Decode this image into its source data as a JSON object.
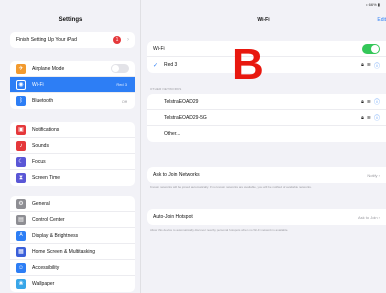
{
  "status": {
    "time": "1:24 PM  Sat Jan 20",
    "right": "• 66% ▮"
  },
  "sidebar": {
    "title": "Settings",
    "setup": {
      "label": "Finish Setting Up Your iPad",
      "badge": "1"
    },
    "group1": [
      {
        "name": "airplane",
        "label": "Airplane Mode",
        "icon": "✈",
        "color": "#f29a2e",
        "value": ""
      },
      {
        "name": "wifi",
        "label": "Wi-Fi",
        "icon": "◉",
        "color": "#2d7ef5",
        "value": "Red 3"
      },
      {
        "name": "bluetooth",
        "label": "Bluetooth",
        "icon": "ᛒ",
        "color": "#2d7ef5",
        "value": "Off"
      }
    ],
    "group2": [
      {
        "name": "notifications",
        "label": "Notifications",
        "icon": "▣",
        "color": "#e5383b"
      },
      {
        "name": "sounds",
        "label": "Sounds",
        "icon": "♪",
        "color": "#e5383b"
      },
      {
        "name": "focus",
        "label": "Focus",
        "icon": "☾",
        "color": "#5a57d6"
      },
      {
        "name": "screen-time",
        "label": "Screen Time",
        "icon": "⧗",
        "color": "#5a57d6"
      }
    ],
    "group3": [
      {
        "name": "general",
        "label": "General",
        "icon": "⚙",
        "color": "#8e8e93"
      },
      {
        "name": "control-center",
        "label": "Control Center",
        "icon": "▤",
        "color": "#8e8e93"
      },
      {
        "name": "display",
        "label": "Display & Brightness",
        "icon": "A",
        "color": "#2d7ef5"
      },
      {
        "name": "home-screen",
        "label": "Home Screen & Multitasking",
        "icon": "▦",
        "color": "#3a5fd9"
      },
      {
        "name": "accessibility",
        "label": "Accessibility",
        "icon": "☺",
        "color": "#2d7ef5"
      },
      {
        "name": "wallpaper",
        "label": "Wallpaper",
        "icon": "❀",
        "color": "#38a6e8"
      }
    ]
  },
  "main": {
    "title": "Wi-Fi",
    "edit": "Edit",
    "wifi_label": "Wi-Fi",
    "connected": "Red 3",
    "other_networks_label": "OTHER NETWORKS",
    "networks": [
      "TelstraEOAD29",
      "TelstraEOAD29-5G"
    ],
    "other": "Other...",
    "ask_join": {
      "label": "Ask to Join Networks",
      "value": "Notify ›"
    },
    "ask_footnote": "Known networks will be joined automatically. If no known networks are available, you will be notified of available networks.",
    "auto_join": {
      "label": "Auto-Join Hotspot",
      "value": "Ask to Join ›"
    },
    "auto_footnote": "Allow this device to automatically discover nearby personal hotspots when no Wi-Fi network is available.",
    "overlay_letter": "B"
  }
}
